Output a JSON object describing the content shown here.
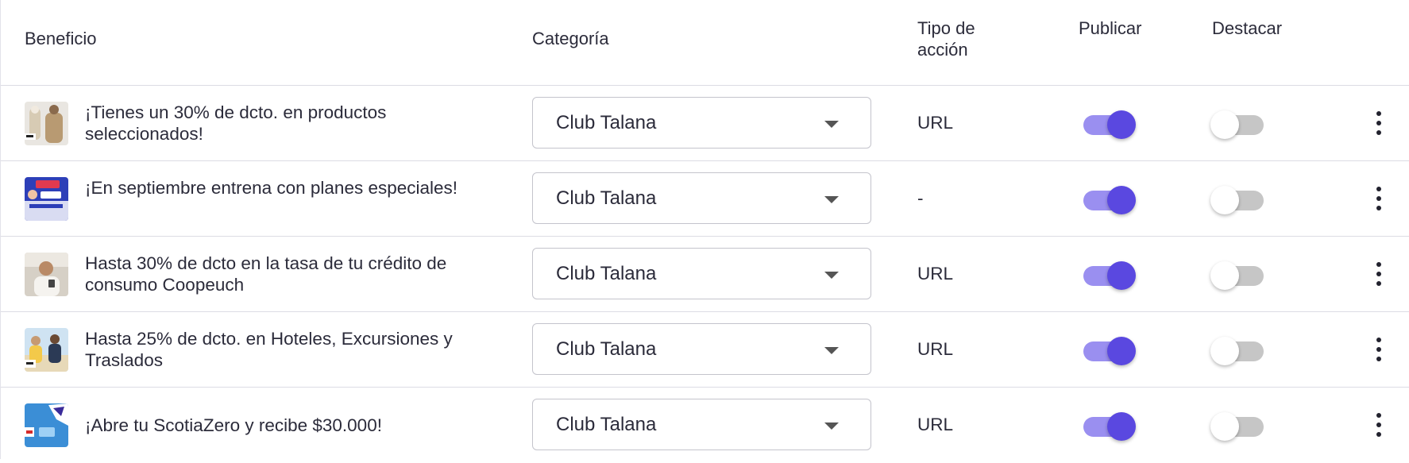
{
  "columns": {
    "beneficio": "Beneficio",
    "categoria": "Categoría",
    "tipo_accion": "Tipo de acción",
    "publicar": "Publicar",
    "destacar": "Destacar"
  },
  "rows": [
    {
      "title": "¡Tienes un 30% de dcto. en productos seleccionados!",
      "category": "Club Talana",
      "action_type": "URL",
      "published": true,
      "featured": false
    },
    {
      "title": "¡En septiembre entrena con planes especiales!",
      "category": "Club Talana",
      "action_type": "-",
      "published": true,
      "featured": false
    },
    {
      "title": "Hasta 30% de dcto en la tasa de tu crédito de consumo Coopeuch",
      "category": "Club Talana",
      "action_type": "URL",
      "published": true,
      "featured": false
    },
    {
      "title": "Hasta 25% de dcto. en Hoteles, Excursiones y Traslados",
      "category": "Club Talana",
      "action_type": "URL",
      "published": true,
      "featured": false
    },
    {
      "title": "¡Abre tu ScotiaZero y recibe $30.000!",
      "category": "Club Talana",
      "action_type": "URL",
      "published": true,
      "featured": false
    }
  ],
  "icons": {
    "dropdown": "chevron-down-icon",
    "more": "more-vertical-icon"
  },
  "colors": {
    "toggle_on_knob": "#5a48e0",
    "toggle_on_track": "#9a8ff0",
    "toggle_off_track": "#c6c6c6",
    "divider": "#dcdce4"
  }
}
